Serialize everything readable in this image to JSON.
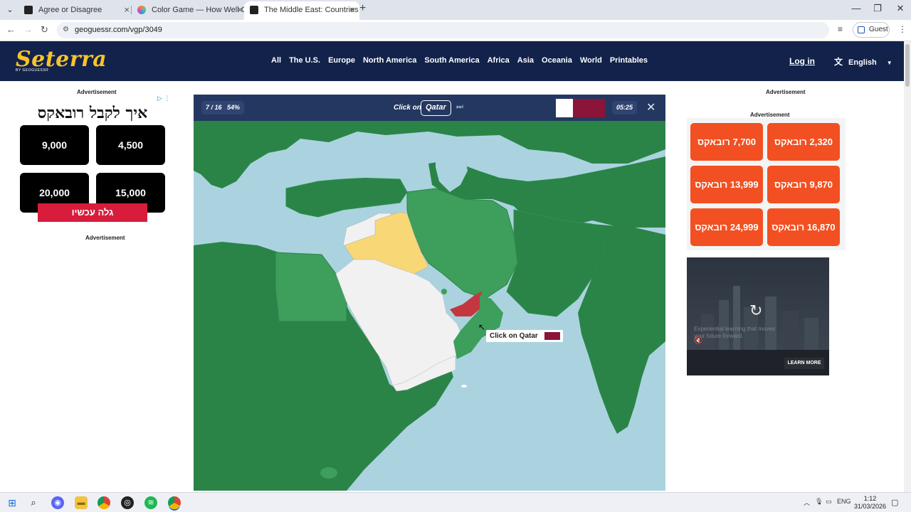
{
  "browser": {
    "tabs": [
      {
        "title": "Agree or Disagree",
        "favicon_color": "#222222"
      },
      {
        "title": "Color Game — How Well Can Y",
        "favicon_color": "#e0457b"
      },
      {
        "title": "The Middle East: Countries - M",
        "favicon_color": "#222222"
      }
    ],
    "url": "geoguessr.com/vgp/3049",
    "profile_label": "Guest"
  },
  "site": {
    "logo": "Seterra",
    "logo_sub": "BY GEOGUESSR",
    "nav": [
      "All",
      "The U.S.",
      "Europe",
      "North America",
      "South America",
      "Africa",
      "Asia",
      "Oceania",
      "World",
      "Printables"
    ],
    "login": "Log in",
    "language": "English"
  },
  "ads": {
    "label": "Advertisement",
    "left_title": "איך לקבל רובאקס",
    "left_boxes": [
      "9,000",
      "4,500",
      "20,000",
      "15,000"
    ],
    "left_cta": "גלה עכשיו",
    "right_offers": [
      "7,700 רובאקס",
      "2,320 רובאקס",
      "13,999 רובאקס",
      "9,870 רובאקס",
      "24,999 רובאקס",
      "16,870 רובאקס"
    ],
    "video_text": "Experiential learning that moves your future forward.",
    "video_cta": "LEARN MORE"
  },
  "game": {
    "progress": "7 / 16",
    "score": "54%",
    "prompt": "Click on",
    "target": "Qatar",
    "timer": "05:25",
    "tooltip": "Click on Qatar",
    "colors": {
      "land": "#2a8447",
      "land_light": "#3e9e5c",
      "water": "#aad3df",
      "unanswered": "#f1f1f1",
      "yellow": "#f8d776",
      "red": "#c33741",
      "qatar_maroon": "#8a1538"
    }
  },
  "taskbar": {
    "lang": "ENG",
    "time": "1:12",
    "date": "31/03/2026"
  }
}
